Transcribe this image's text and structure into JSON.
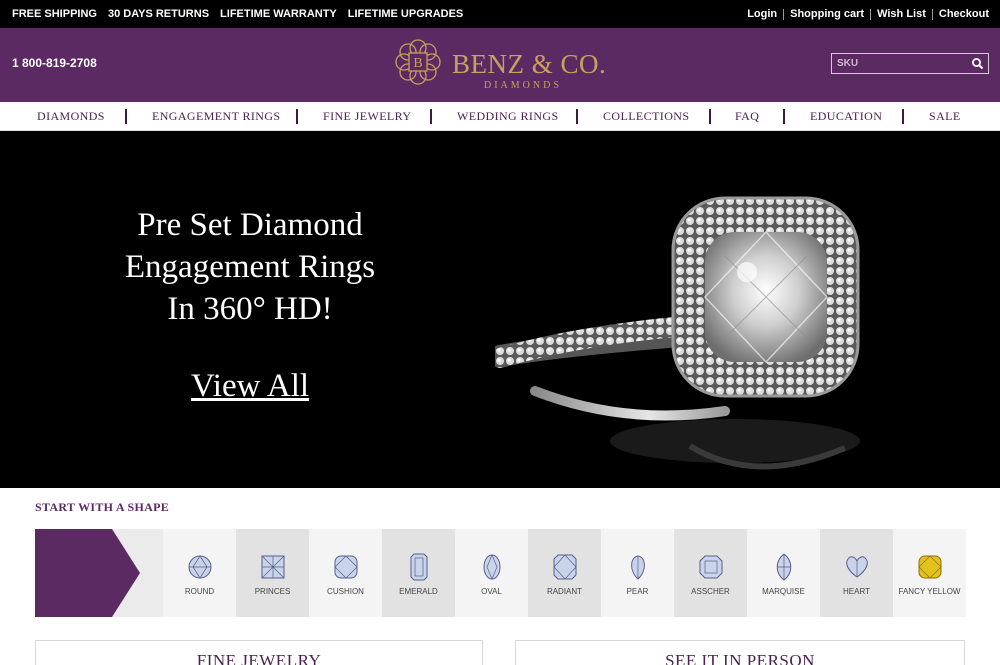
{
  "topbar": {
    "promos": [
      "FREE SHIPPING",
      "30 DAYS RETURNS",
      "LIFETIME WARRANTY",
      "LIFETIME UPGRADES"
    ],
    "links": [
      "Login",
      "Shopping cart",
      "Wish List",
      "Checkout"
    ]
  },
  "header": {
    "phone": "1 800-819-2708",
    "logo_letter": "B",
    "logo_name": "BENZ & CO.",
    "logo_sub": "DIAMONDS",
    "search_placeholder": "SKU",
    "search_icon": "search-icon"
  },
  "colors": {
    "brand_purple": "#5c2a63",
    "gold": "#c9a05c",
    "nav_text": "#4a2150"
  },
  "nav": {
    "items": [
      "DIAMONDS",
      "ENGAGEMENT RINGS",
      "FINE JEWELRY",
      "WEDDING RINGS",
      "COLLECTIONS",
      "FAQ",
      "EDUCATION",
      "SALE"
    ]
  },
  "hero": {
    "title_lines": [
      "Pre Set Diamond",
      "Engagement Rings",
      "In 360° HD!"
    ],
    "cta": "View All"
  },
  "shapes": {
    "heading": "START WITH A SHAPE",
    "items": [
      "ROUND",
      "PRINCES",
      "CUSHION",
      "EMERALD",
      "OVAL",
      "RADIANT",
      "PEAR",
      "ASSCHER",
      "MARQUISE",
      "HEART",
      "FANCY YELLOW"
    ]
  },
  "cards": [
    {
      "title": "FINE JEWELRY"
    },
    {
      "title": "SEE IT IN PERSON"
    }
  ]
}
